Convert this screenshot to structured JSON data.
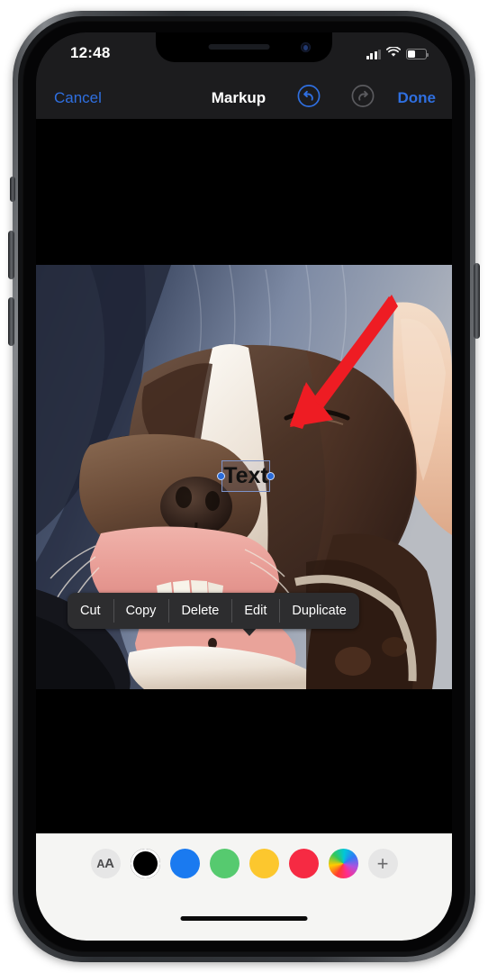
{
  "device": {
    "name": "iphone-11-pro",
    "frame_color": "#3c3f43"
  },
  "status_bar": {
    "time": "12:48",
    "cellular_bars_filled": 3,
    "cellular_bars_total": 4,
    "wifi": "wifi-icon",
    "battery_percent": 38,
    "battery_icon": "battery-icon"
  },
  "nav_bar": {
    "cancel_label": "Cancel",
    "title": "Markup",
    "done_label": "Done",
    "undo_icon": "undo-icon",
    "undo_enabled": true,
    "redo_icon": "redo-icon",
    "redo_enabled": false,
    "tint_color": "#2f6fe0",
    "disabled_color": "#636366",
    "background": "#1c1c1e"
  },
  "canvas": {
    "background": "#000000",
    "photo_alt": "close-up of a brown and white dog lying on a blue blanket with a person's arm",
    "annotation_arrow": {
      "name": "red-arrow-annotation",
      "color": "#ee1c23",
      "points_to": "Edit"
    }
  },
  "text_object": {
    "value": "Text",
    "selected": true,
    "selection_border_color": "#7d93c9",
    "handle_color": "#2a6bd8"
  },
  "context_menu": {
    "background": "#2d2d2f",
    "items": [
      {
        "label": "Cut",
        "name": "cut"
      },
      {
        "label": "Copy",
        "name": "copy"
      },
      {
        "label": "Delete",
        "name": "delete"
      },
      {
        "label": "Edit",
        "name": "edit"
      },
      {
        "label": "Duplicate",
        "name": "duplicate"
      }
    ]
  },
  "toolbar": {
    "background": "#f5f5f3",
    "text_format_label_small": "A",
    "text_format_label_big": "A",
    "add_label": "+",
    "selected_color_index": 0,
    "colors": [
      {
        "name": "black",
        "hex": "#000000",
        "selected": true
      },
      {
        "name": "blue",
        "hex": "#1a7af0"
      },
      {
        "name": "green",
        "hex": "#56ca6f"
      },
      {
        "name": "yellow",
        "hex": "#fcc72e"
      },
      {
        "name": "red",
        "hex": "#f62a43"
      },
      {
        "name": "color-wheel",
        "hex": "multicolor"
      }
    ]
  },
  "home_indicator": {
    "color": "#0b0b0b"
  }
}
